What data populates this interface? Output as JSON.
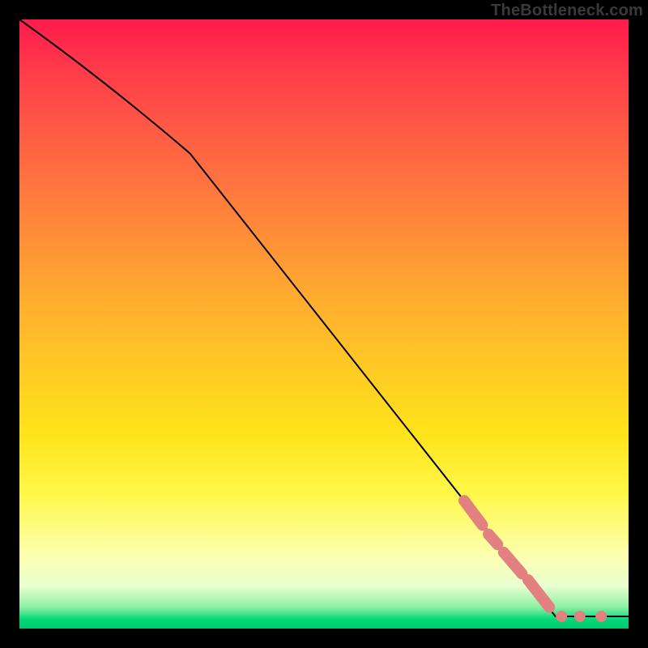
{
  "watermark": "TheBottleneck.com",
  "chart_data": {
    "type": "line",
    "title": "",
    "xlabel": "",
    "ylabel": "",
    "xlim": [
      0,
      100
    ],
    "ylim": [
      0,
      100
    ],
    "note": "Axes are not displayed; values are normalized percentages read off the plot area (0 = left/bottom, 100 = right/top).",
    "curve": {
      "name": "bottleneck-curve",
      "points": [
        {
          "x": 0,
          "y": 100
        },
        {
          "x": 28,
          "y": 78
        },
        {
          "x": 88,
          "y": 2
        },
        {
          "x": 100,
          "y": 2
        }
      ]
    },
    "highlight_segments": [
      {
        "x1": 73.0,
        "y1": 21.0,
        "x2": 76.0,
        "y2": 17.0
      },
      {
        "x1": 77.0,
        "y1": 15.5,
        "x2": 78.5,
        "y2": 13.8
      },
      {
        "x1": 79.5,
        "y1": 12.5,
        "x2": 82.5,
        "y2": 9.0
      },
      {
        "x1": 83.5,
        "y1": 8.0,
        "x2": 87.0,
        "y2": 3.5
      }
    ],
    "highlight_points": [
      {
        "x": 89.0,
        "y": 2.0
      },
      {
        "x": 92.0,
        "y": 2.0
      },
      {
        "x": 95.5,
        "y": 2.0
      }
    ],
    "gradient_stops": [
      {
        "pos": 0,
        "color": "#ff1a4d"
      },
      {
        "pos": 0.5,
        "color": "#ffc427"
      },
      {
        "pos": 0.88,
        "color": "#fdffb0"
      },
      {
        "pos": 1.0,
        "color": "#00c96e"
      }
    ]
  }
}
